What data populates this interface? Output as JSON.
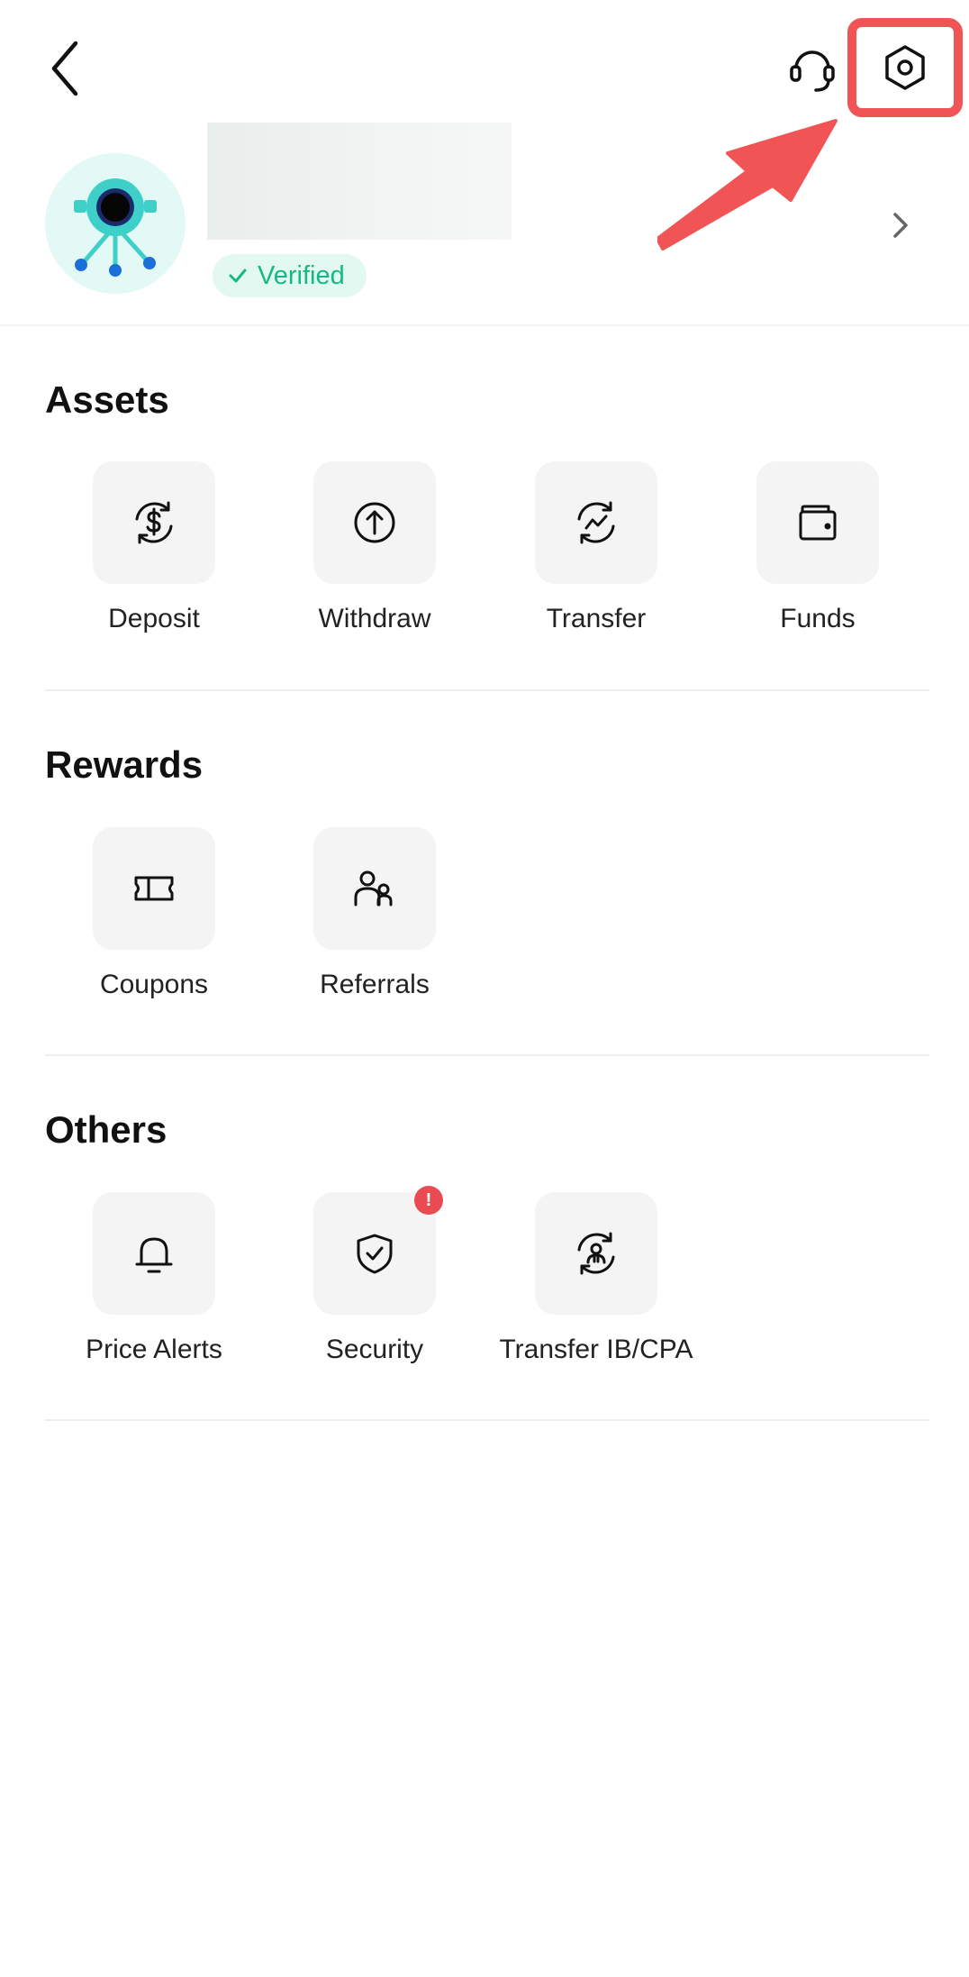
{
  "header": {
    "back_icon": "chevron-left-icon",
    "support_icon": "headset-icon",
    "settings_icon": "hexagon-gear-icon",
    "highlight_color": "#f05454"
  },
  "profile": {
    "verified_label": "Verified",
    "verified_color": "#16b886",
    "avatar_icon": "robot-eye-avatar"
  },
  "sections": {
    "assets": {
      "title": "Assets",
      "items": [
        {
          "label": "Deposit",
          "icon": "dollar-cycle-icon"
        },
        {
          "label": "Withdraw",
          "icon": "arrow-up-circle-icon"
        },
        {
          "label": "Transfer",
          "icon": "chart-cycle-icon"
        },
        {
          "label": "Funds",
          "icon": "wallet-icon"
        }
      ]
    },
    "rewards": {
      "title": "Rewards",
      "items": [
        {
          "label": "Coupons",
          "icon": "ticket-icon"
        },
        {
          "label": "Referrals",
          "icon": "users-icon"
        }
      ]
    },
    "others": {
      "title": "Others",
      "items": [
        {
          "label": "Price Alerts",
          "icon": "bell-icon"
        },
        {
          "label": "Security",
          "icon": "shield-check-icon",
          "badge": "!"
        },
        {
          "label": "Transfer IB/CPA",
          "icon": "person-cycle-icon"
        }
      ]
    }
  }
}
